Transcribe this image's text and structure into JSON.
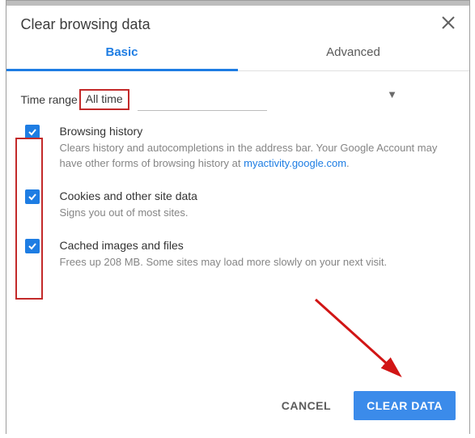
{
  "header": {
    "title": "Clear browsing data"
  },
  "tabs": {
    "basic": "Basic",
    "advanced": "Advanced"
  },
  "time": {
    "label": "Time range",
    "value": "All time"
  },
  "options": {
    "browsing": {
      "title": "Browsing history",
      "desc_a": "Clears history and autocompletions in the address bar. Your Google Account may have other forms of browsing history at ",
      "link": "myactivity.google.com",
      "desc_b": "."
    },
    "cookies": {
      "title": "Cookies and other site data",
      "desc": "Signs you out of most sites."
    },
    "cache": {
      "title": "Cached images and files",
      "desc": "Frees up 208 MB. Some sites may load more slowly on your next visit."
    }
  },
  "actions": {
    "cancel": "CANCEL",
    "clear": "CLEAR DATA"
  }
}
